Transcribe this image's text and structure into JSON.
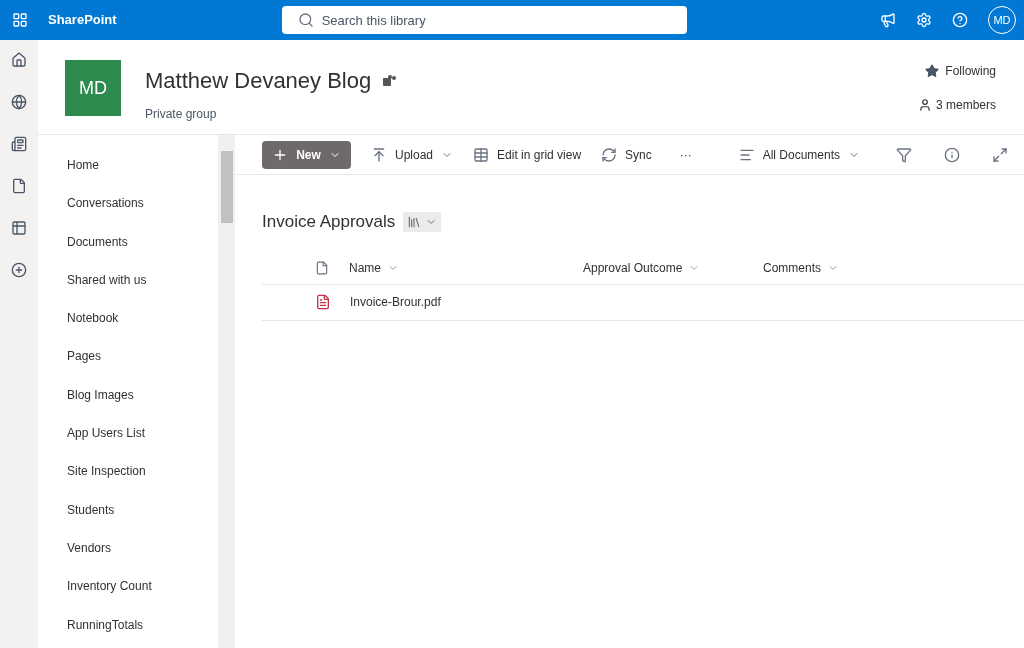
{
  "top_bar": {
    "app_name": "SharePoint",
    "search": {
      "placeholder": "Search this library"
    },
    "avatar": "MD"
  },
  "site": {
    "logo": "MD",
    "title": "Matthew Devaney Blog",
    "subtitle": "Private group",
    "following": "Following",
    "members": "3 members"
  },
  "nav": [
    {
      "label": "Home"
    },
    {
      "label": "Conversations"
    },
    {
      "label": "Documents"
    },
    {
      "label": "Shared with us"
    },
    {
      "label": "Notebook"
    },
    {
      "label": "Pages"
    },
    {
      "label": "Blog Images"
    },
    {
      "label": "App Users List"
    },
    {
      "label": "Site Inspection"
    },
    {
      "label": "Students"
    },
    {
      "label": "Vendors"
    },
    {
      "label": "Inventory Count"
    },
    {
      "label": "RunningTotals"
    }
  ],
  "command_bar": {
    "new": "New",
    "upload": "Upload",
    "grid": "Edit in grid view",
    "sync": "Sync",
    "more": "···",
    "view": "All Documents"
  },
  "library": {
    "title": "Invoice Approvals",
    "columns": [
      "Name",
      "Approval Outcome",
      "Comments"
    ],
    "rows": [
      {
        "name": "Invoice-Brour.pdf"
      }
    ]
  }
}
